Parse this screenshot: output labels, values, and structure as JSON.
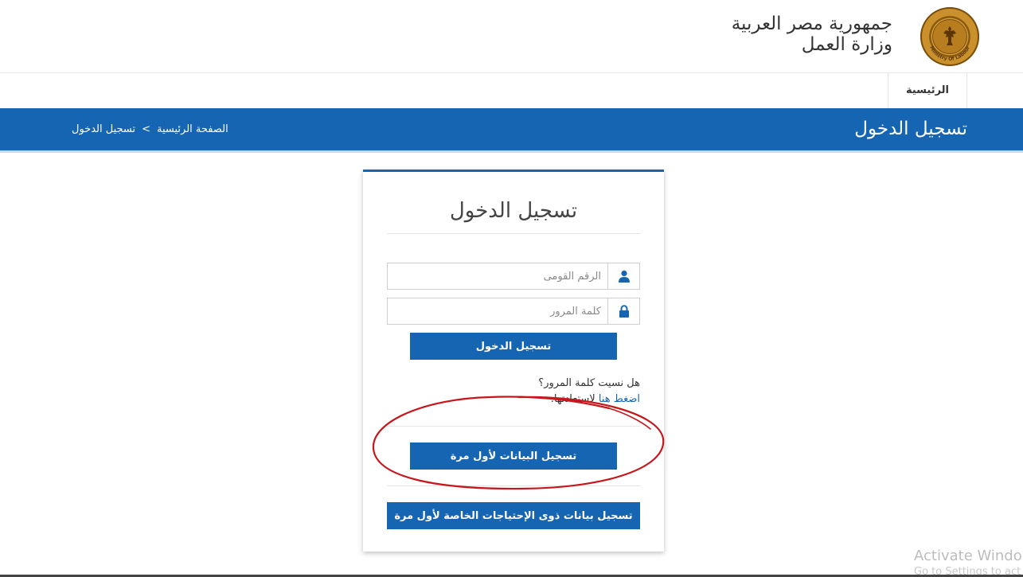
{
  "header": {
    "country": "جمهورية مصر العربية",
    "ministry": "وزارة العمل",
    "logo_text": "Ministry Of Labour"
  },
  "nav": {
    "home": "الرئيسية"
  },
  "banner": {
    "title": "تسجيل الدخول",
    "breadcrumb": {
      "home": "الصفحة الرئيسية",
      "separator": ">",
      "current": "تسجيل الدخول"
    }
  },
  "login": {
    "title": "تسجيل الدخول",
    "national_id_placeholder": "الرقم القومى",
    "password_placeholder": "كلمة المرور",
    "submit_label": "تسجيل الدخول",
    "forgot_question": "هل نسيت كلمة المرور؟",
    "forgot_link": "اضغط هنا",
    "forgot_rest": " لاستعادتها.",
    "register_first_time": "تسجيل البيانات لأول مرة",
    "register_special_needs": "تسجيل بيانات ذوى الإحتياجات الخاصة لأول مرة"
  },
  "annotation_color": "#c8161d",
  "accent_color": "#1565b3",
  "watermark": {
    "line1": "Activate Windo",
    "line2": "Go to Settings to act"
  }
}
